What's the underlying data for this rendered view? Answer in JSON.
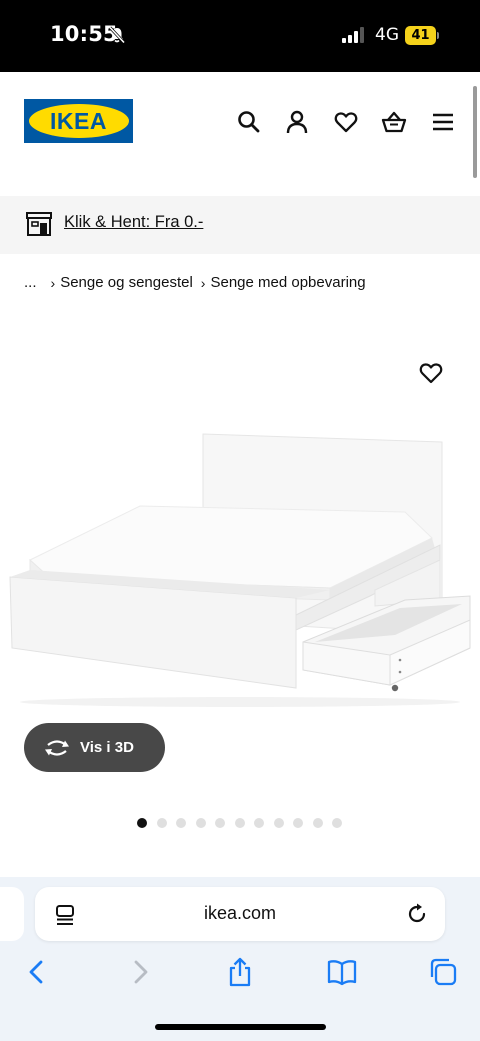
{
  "status_bar": {
    "time": "10:55",
    "network": "4G",
    "battery": "41"
  },
  "header": {
    "logo_text": "IKEA",
    "brand_colors": {
      "blue": "#0058a3",
      "yellow": "#ffdb00"
    },
    "icons": [
      "search-icon",
      "account-icon",
      "heart-icon",
      "basket-icon",
      "menu-icon"
    ]
  },
  "promo": {
    "link_text": "Klik & Hent: Fra 0.-"
  },
  "breadcrumb": {
    "ellipsis": "...",
    "items": [
      "Senge og sengestel",
      "Senge med opbevaring"
    ]
  },
  "product": {
    "view_3d_label": "Vis i 3D",
    "dots_total": 11,
    "active_dot": 0
  },
  "browser": {
    "address": "ikea.com"
  }
}
